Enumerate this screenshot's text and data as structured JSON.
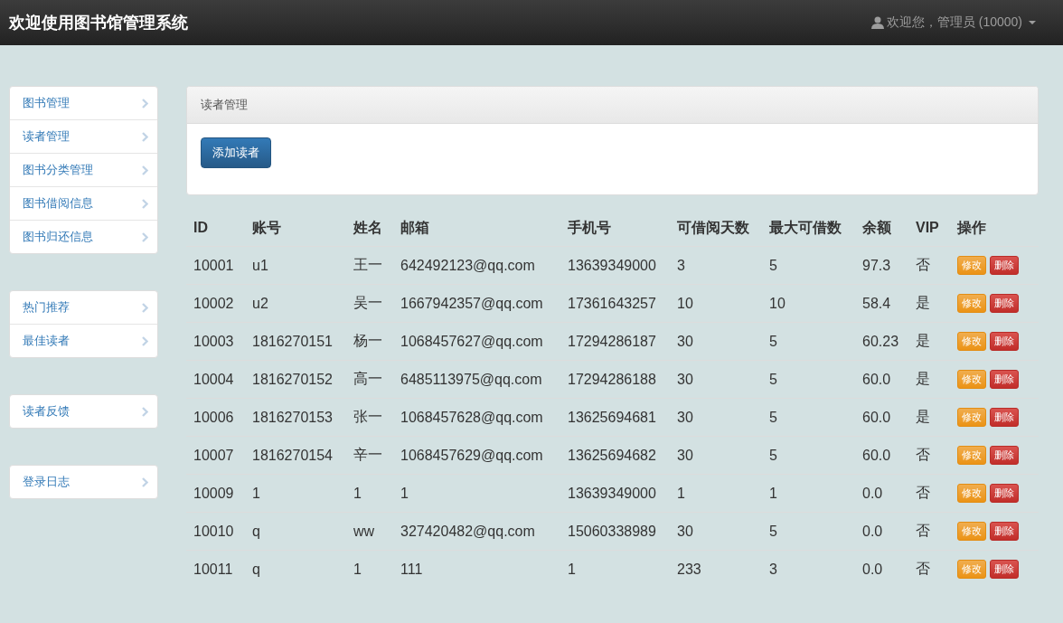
{
  "navbar": {
    "brand": "欢迎使用图书馆管理系统",
    "user": "欢迎您，管理员 (10000)"
  },
  "sidebar": {
    "groups": [
      {
        "items": [
          {
            "label": "图书管理"
          },
          {
            "label": "读者管理"
          },
          {
            "label": "图书分类管理"
          },
          {
            "label": "图书借阅信息"
          },
          {
            "label": "图书归还信息"
          }
        ]
      },
      {
        "items": [
          {
            "label": "热门推荐"
          },
          {
            "label": "最佳读者"
          }
        ]
      },
      {
        "items": [
          {
            "label": "读者反馈"
          }
        ]
      },
      {
        "items": [
          {
            "label": "登录日志"
          }
        ]
      }
    ]
  },
  "panel": {
    "heading": "读者管理",
    "button": "添加读者"
  },
  "table": {
    "columns": [
      "ID",
      "账号",
      "姓名",
      "邮箱",
      "手机号",
      "可借阅天数",
      "最大可借数",
      "余额",
      "VIP",
      "操作"
    ],
    "rows": [
      {
        "cells": [
          "10001",
          "u1",
          "王一",
          "642492123@qq.com",
          "13639349000",
          "3",
          "5",
          "97.3",
          "否"
        ],
        "actions": [
          {
            "kind": "edit",
            "label": "修改"
          },
          {
            "kind": "delete",
            "label": "删除"
          }
        ]
      },
      {
        "cells": [
          "10002",
          "u2",
          "吴一",
          "1667942357@qq.com",
          "17361643257",
          "10",
          "10",
          "58.4",
          "是"
        ],
        "actions": [
          {
            "kind": "edit",
            "label": "修改"
          },
          {
            "kind": "delete",
            "label": "删除"
          }
        ]
      },
      {
        "cells": [
          "10003",
          "1816270151",
          "杨一",
          "1068457627@qq.com",
          "17294286187",
          "30",
          "5",
          "60.23",
          "是"
        ],
        "actions": [
          {
            "kind": "edit",
            "label": "修改"
          },
          {
            "kind": "delete",
            "label": "删除"
          }
        ]
      },
      {
        "cells": [
          "10004",
          "1816270152",
          "高一",
          "6485113975@qq.com",
          "17294286188",
          "30",
          "5",
          "60.0",
          "是"
        ],
        "actions": [
          {
            "kind": "edit",
            "label": "修改"
          },
          {
            "kind": "delete",
            "label": "删除"
          }
        ]
      },
      {
        "cells": [
          "10006",
          "1816270153",
          "张一",
          "1068457628@qq.com",
          "13625694681",
          "30",
          "5",
          "60.0",
          "是"
        ],
        "actions": [
          {
            "kind": "edit",
            "label": "修改"
          },
          {
            "kind": "delete",
            "label": "删除"
          }
        ]
      },
      {
        "cells": [
          "10007",
          "1816270154",
          "辛一",
          "1068457629@qq.com",
          "13625694682",
          "30",
          "5",
          "60.0",
          "否"
        ],
        "actions": [
          {
            "kind": "edit",
            "label": "修改"
          },
          {
            "kind": "delete",
            "label": "删除"
          }
        ]
      },
      {
        "cells": [
          "10009",
          "1",
          "1",
          "1",
          "13639349000",
          "1",
          "1",
          "0.0",
          "否"
        ],
        "actions": [
          {
            "kind": "edit",
            "label": "修改"
          },
          {
            "kind": "delete",
            "label": "删除"
          }
        ]
      },
      {
        "cells": [
          "10010",
          "q",
          "ww",
          "327420482@qq.com",
          "15060338989",
          "30",
          "5",
          "0.0",
          "否"
        ],
        "actions": [
          {
            "kind": "edit",
            "label": "修改"
          },
          {
            "kind": "delete",
            "label": "删除"
          }
        ]
      },
      {
        "cells": [
          "10011",
          "q",
          "1",
          "111",
          "1",
          "233",
          "3",
          "0.0",
          "否"
        ],
        "actions": [
          {
            "kind": "edit",
            "label": "修改"
          },
          {
            "kind": "delete",
            "label": "删除"
          }
        ]
      }
    ]
  }
}
